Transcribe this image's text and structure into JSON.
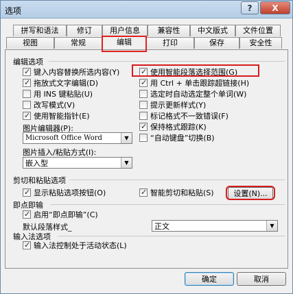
{
  "window": {
    "title": "选项",
    "help_label": "?",
    "close_label": "X"
  },
  "tabs_row1": [
    "拼写和语法",
    "修订",
    "用户信息",
    "兼容性",
    "中文版式",
    "文件位置"
  ],
  "tabs_row2": [
    "视图",
    "常规",
    "编辑",
    "打印",
    "保存",
    "安全性"
  ],
  "active_tab": "编辑",
  "edit_options": {
    "heading": "编辑选项",
    "left": [
      {
        "label": "键入内容替换所选内容(Y)",
        "checked": true
      },
      {
        "label": "拖放式文字编辑(D)",
        "checked": true
      },
      {
        "label": "用 INS 键粘贴(U)",
        "checked": false
      },
      {
        "label": "改写模式(V)",
        "checked": false
      },
      {
        "label": "使用智能指针(E)",
        "checked": true
      }
    ],
    "right": [
      {
        "label": "使用智能段落选择范围(G)",
        "checked": true
      },
      {
        "label": "用 Ctrl + 单击跟踪超链接(H)",
        "checked": true
      },
      {
        "label": "选定时自动选定整个单词(W)",
        "checked": false
      },
      {
        "label": "提示更新样式(Y)",
        "checked": false
      },
      {
        "label": "标记格式不一致错误(F)",
        "checked": false
      },
      {
        "label": "保持格式跟踪(K)",
        "checked": true
      },
      {
        "label": "“自动键盘”切换(B)",
        "checked": false
      }
    ],
    "picture_editor_label": "图片编辑器(P):",
    "picture_editor_value": "Microsoft Office Word",
    "insert_paste_label": "图片插入/粘贴方式(I):",
    "insert_paste_value": "嵌入型"
  },
  "cut_paste": {
    "heading": "剪切和粘贴选项",
    "show_paste_buttons": {
      "label": "显示粘贴选项按钮(O)",
      "checked": true
    },
    "smart_cut_paste": {
      "label": "智能剪切和粘贴(S)",
      "checked": true
    },
    "settings_button": "设置(N)..."
  },
  "click_type": {
    "heading": "即点即输",
    "enable": {
      "label": "启用“即点即输”(C)",
      "checked": true
    },
    "default_style_label": "默认段落样式_",
    "default_style_value": "正文"
  },
  "ime": {
    "heading": "输入法选项",
    "control": {
      "label": "输入法控制处于活动状态(L)",
      "checked": true
    }
  },
  "footer": {
    "ok": "确定",
    "cancel": "取消"
  }
}
